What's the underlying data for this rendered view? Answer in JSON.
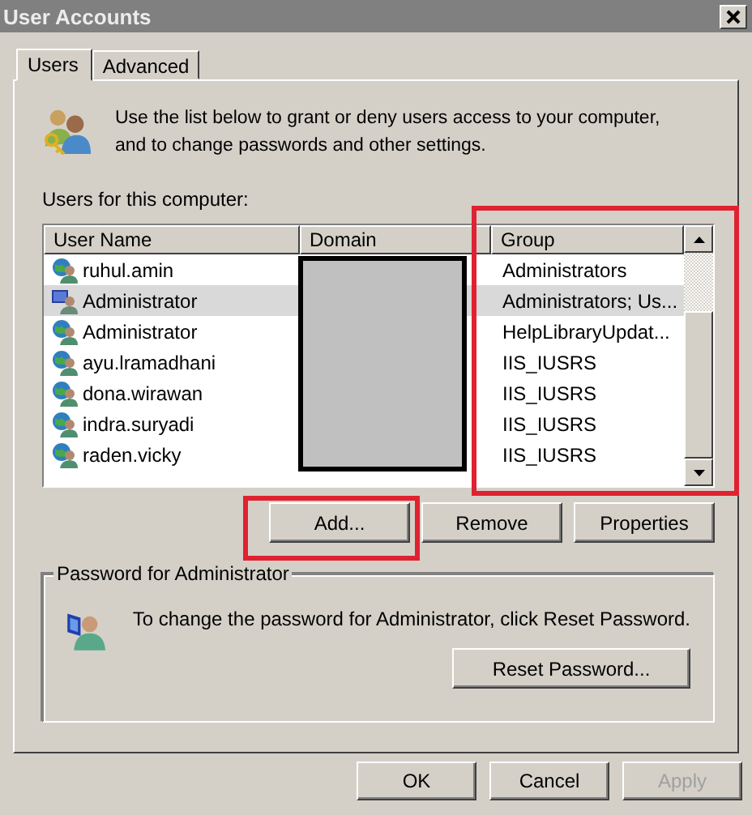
{
  "window": {
    "title": "User Accounts"
  },
  "tabs": [
    {
      "label": "Users",
      "selected": true
    },
    {
      "label": "Advanced",
      "selected": false
    }
  ],
  "intro": "Use the list below to grant or deny users access to your computer, and to change passwords and other settings.",
  "users_label": "Users for this computer:",
  "table": {
    "columns": [
      "User Name",
      "Domain",
      "Group"
    ],
    "rows": [
      {
        "kind": "domain",
        "user_name": "ruhul.amin",
        "group": "Administrators",
        "selected": false
      },
      {
        "kind": "local",
        "user_name": "Administrator",
        "group": "Administrators; Us...",
        "selected": true
      },
      {
        "kind": "domain",
        "user_name": "Administrator",
        "group": "HelpLibraryUpdat...",
        "selected": false
      },
      {
        "kind": "domain",
        "user_name": "ayu.lramadhani",
        "group": "IIS_IUSRS",
        "selected": false
      },
      {
        "kind": "domain",
        "user_name": "dona.wirawan",
        "group": "IIS_IUSRS",
        "selected": false
      },
      {
        "kind": "domain",
        "user_name": "indra.suryadi",
        "group": "IIS_IUSRS",
        "selected": false
      },
      {
        "kind": "domain",
        "user_name": "raden.vicky",
        "group": "IIS_IUSRS",
        "selected": false
      }
    ]
  },
  "list_buttons": [
    {
      "label": "Add..."
    },
    {
      "label": "Remove"
    },
    {
      "label": "Properties"
    }
  ],
  "password_group": {
    "title": "Password for Administrator",
    "message": "To change the password for Administrator, click Reset Password.",
    "button": "Reset Password..."
  },
  "dialog_buttons": [
    {
      "label": "OK",
      "disabled": false
    },
    {
      "label": "Cancel",
      "disabled": false
    },
    {
      "label": "Apply",
      "disabled": true
    }
  ]
}
